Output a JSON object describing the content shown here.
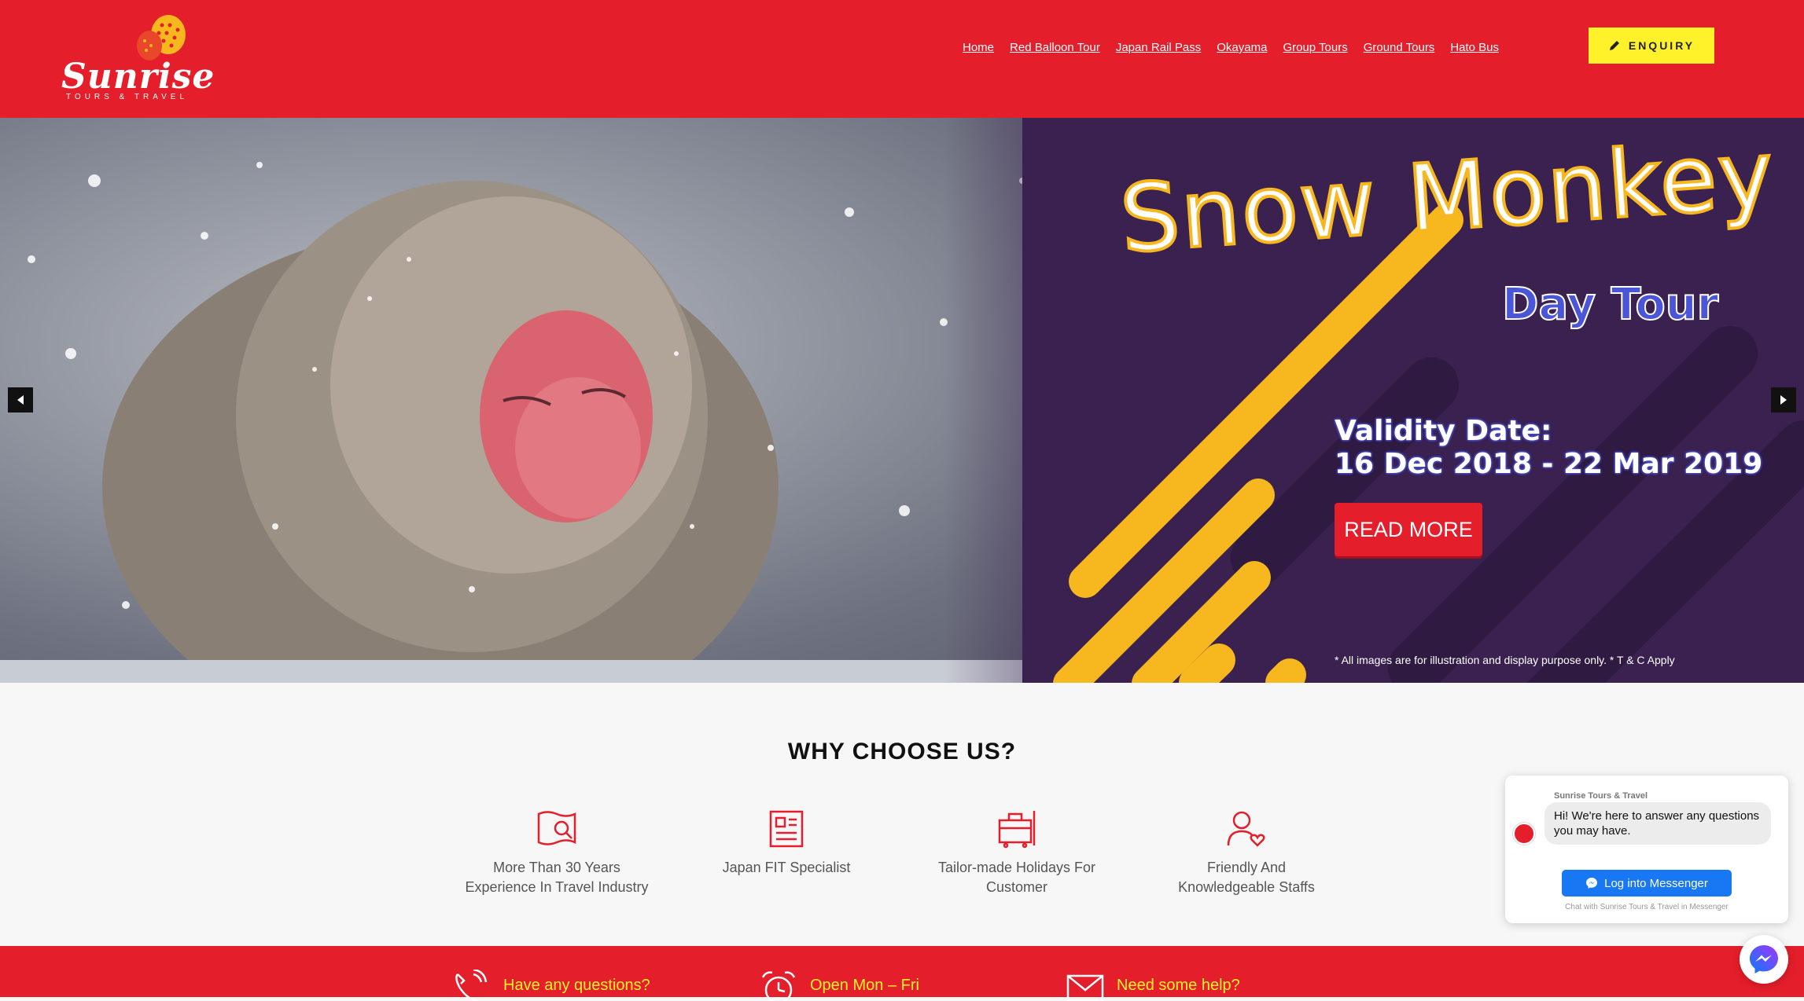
{
  "brand": {
    "name": "Sunrise",
    "tagline": "TOURS & TRAVEL"
  },
  "nav": {
    "items": [
      "Home",
      "Red Balloon Tour",
      "Japan Rail Pass",
      "Okayama",
      "Group Tours",
      "Ground Tours",
      "Hato Bus"
    ]
  },
  "enquiry": {
    "label": "ENQUIRY",
    "icon": "pencil-icon"
  },
  "hero": {
    "title": "Snow Monkey",
    "subtitle": "Day Tour",
    "validity_label": "Validity Date:",
    "validity_dates": "16 Dec 2018 - 22 Mar 2019",
    "cta": "READ MORE",
    "disclaimer": "* All images are for illustration and display purpose only.  * T & C Apply"
  },
  "why": {
    "title": "WHY CHOOSE US?",
    "features": [
      {
        "icon": "map-search-icon",
        "line1": "More Than 30 Years",
        "line2": "Experience In Travel Industry"
      },
      {
        "icon": "document-icon",
        "line1": "Japan FIT Specialist",
        "line2": ""
      },
      {
        "icon": "luggage-icon",
        "line1": "Tailor-made Holidays For",
        "line2": "Customer"
      },
      {
        "icon": "user-heart-icon",
        "line1": "Friendly And",
        "line2": "Knowledgeable Staffs"
      }
    ]
  },
  "contact": [
    {
      "icon": "phone-icon",
      "text": "Have any questions?"
    },
    {
      "icon": "alarm-clock-icon",
      "text": "Open Mon – Fri"
    },
    {
      "icon": "envelope-icon",
      "text": "Need some help?"
    }
  ],
  "messenger": {
    "page_name": "Sunrise Tours & Travel",
    "greeting": "Hi! We're here to answer any questions you may have.",
    "login": "Log into Messenger",
    "caption": "Chat with Sunrise Tours & Travel in Messenger"
  },
  "colors": {
    "brand_red": "#e41e2a",
    "accent_yellow": "#fff22a",
    "panel_purple": "#3a2150",
    "stripe_yellow": "#f7b71f",
    "messenger_blue": "#1877f2"
  }
}
